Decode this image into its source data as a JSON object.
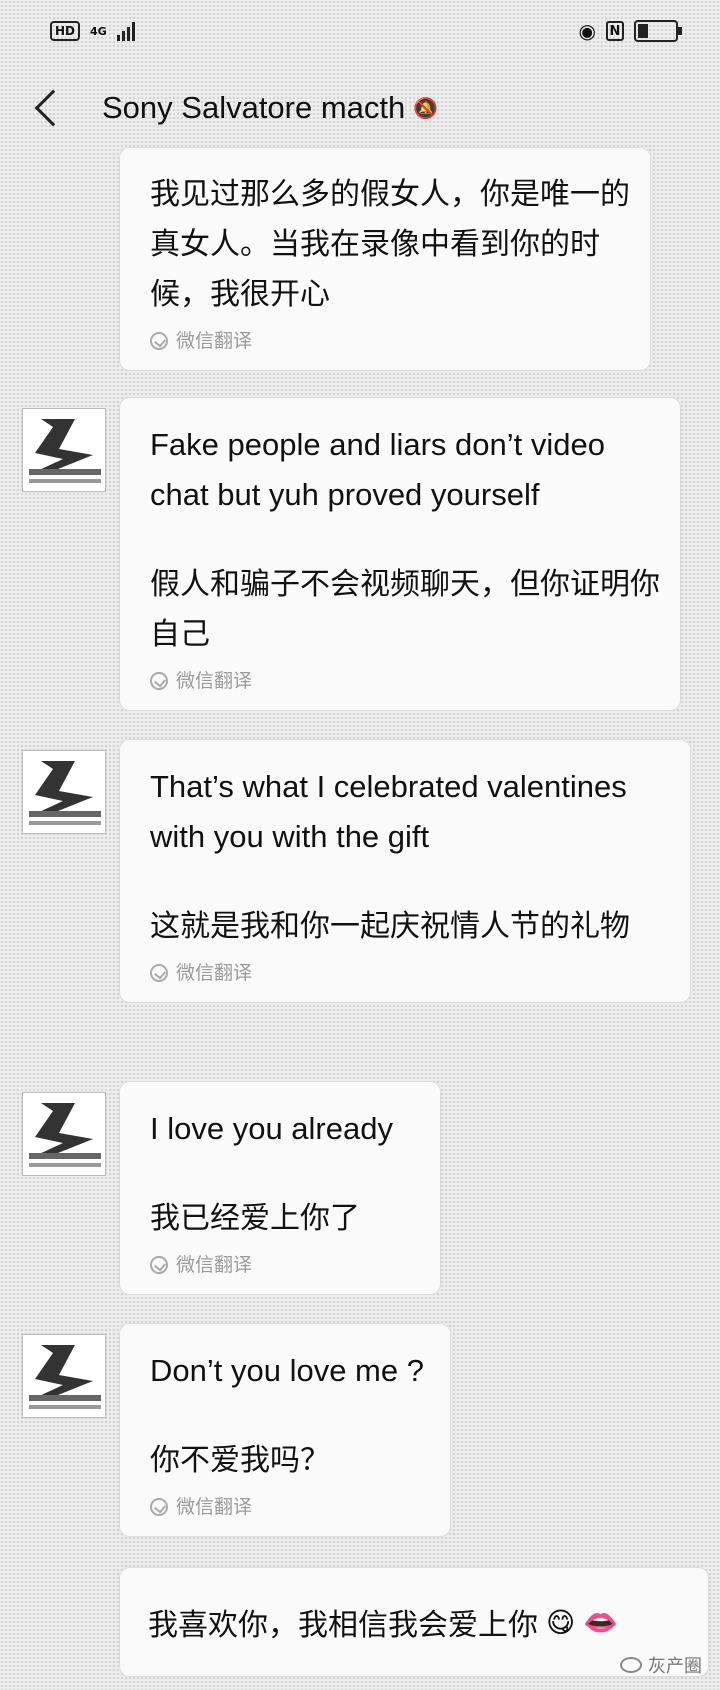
{
  "status_bar": {
    "hd": "HD",
    "network": "4G"
  },
  "header": {
    "title": "Sony Salvatore  macth"
  },
  "messages": [
    {
      "sender": "contact",
      "text": "",
      "translation": "我见过那么多的假女人，你是唯一的真女人。当我在录像中看到你的时候，我很开心",
      "translate_label": "微信翻译"
    },
    {
      "sender": "contact",
      "text": "Fake people and liars don’t video chat but yuh proved yourself",
      "translation": "假人和骗子不会视频聊天，但你证明你自己",
      "translate_label": "微信翻译"
    },
    {
      "sender": "contact",
      "text": "That’s what I celebrated valentines with you with the gift",
      "translation": "这就是我和你一起庆祝情人节的礼物",
      "translate_label": "微信翻译"
    },
    {
      "sender": "contact",
      "text": "I love you already",
      "translation": "我已经爱上你了",
      "translate_label": "微信翻译"
    },
    {
      "sender": "contact",
      "text": "Don’t you love me ?",
      "translation": "你不爱我吗？",
      "translate_label": "微信翻译"
    }
  ],
  "input": {
    "text": "我喜欢你，我相信我会爱上你",
    "emoji1": "😋",
    "emoji2": "👄"
  },
  "watermark": "灰产圈"
}
